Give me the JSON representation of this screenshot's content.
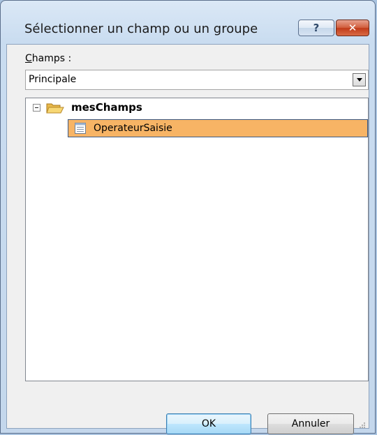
{
  "window": {
    "title": "Sélectionner un champ ou un groupe",
    "help_label": "?",
    "close_label": "✕"
  },
  "fields": {
    "label_underlined": "C",
    "label_rest": "hamps :",
    "source_selected": "Principale"
  },
  "tree": {
    "root": {
      "label": "mesChamps",
      "expanded": true
    },
    "children": [
      {
        "label": "OperateurSaisie",
        "selected": true
      }
    ]
  },
  "buttons": {
    "ok_label": "OK",
    "cancel_label": "Annuler"
  },
  "colors": {
    "selection_fill": "#f7b465",
    "selection_border": "#3b5a86",
    "close_button": "#c13b1a"
  },
  "icons": {
    "expander": "minus-box-icon",
    "root": "open-folder-icon",
    "field": "field-icon",
    "dropdown": "chevron-down-icon"
  }
}
